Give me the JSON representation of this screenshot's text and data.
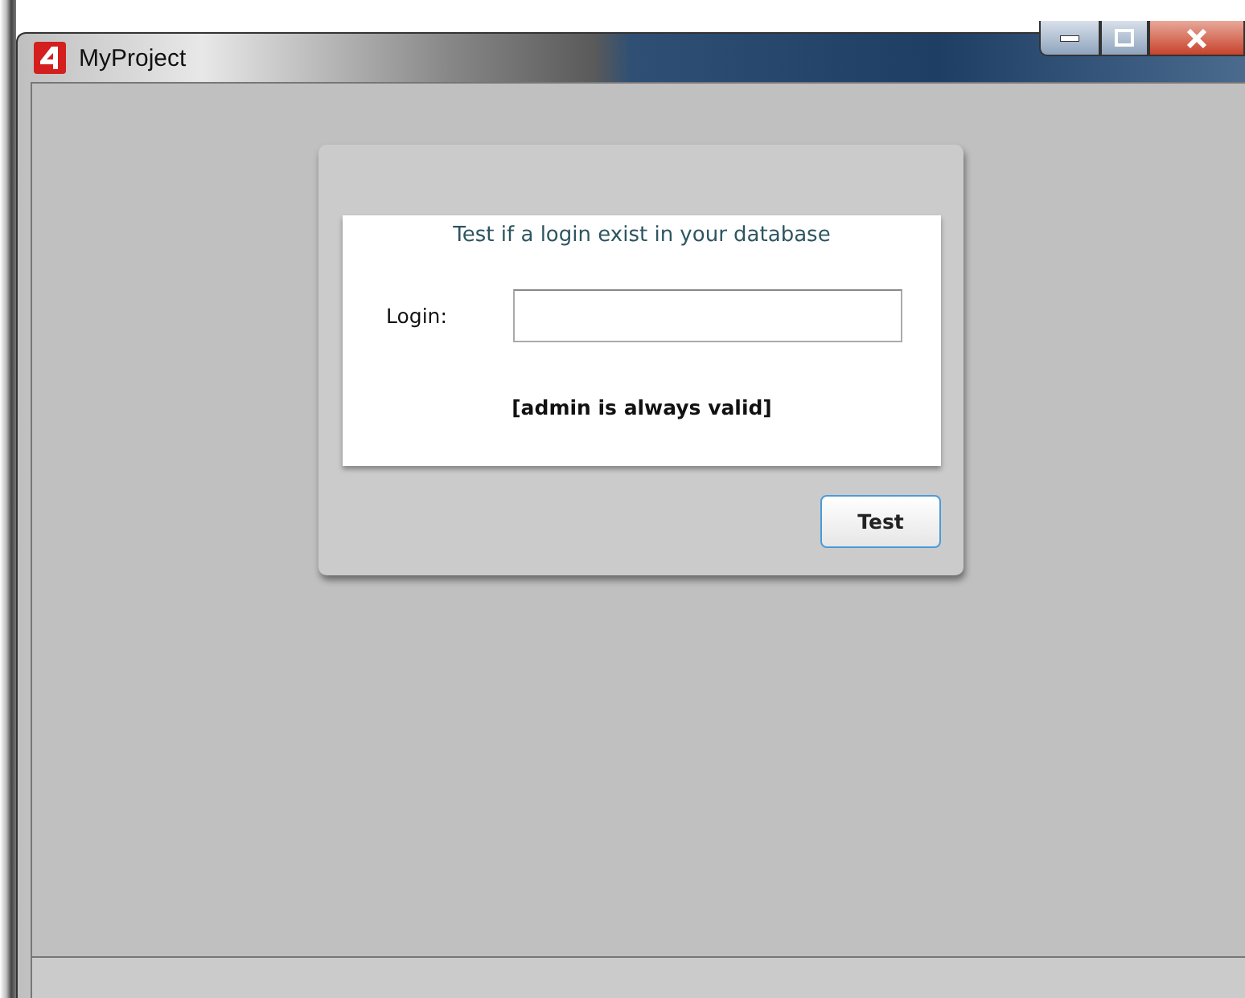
{
  "window": {
    "title": "MyProject"
  },
  "form": {
    "heading": "Test if a login exist in your database",
    "login_label": "Login:",
    "note": "[admin is always valid]",
    "button": "Test"
  }
}
